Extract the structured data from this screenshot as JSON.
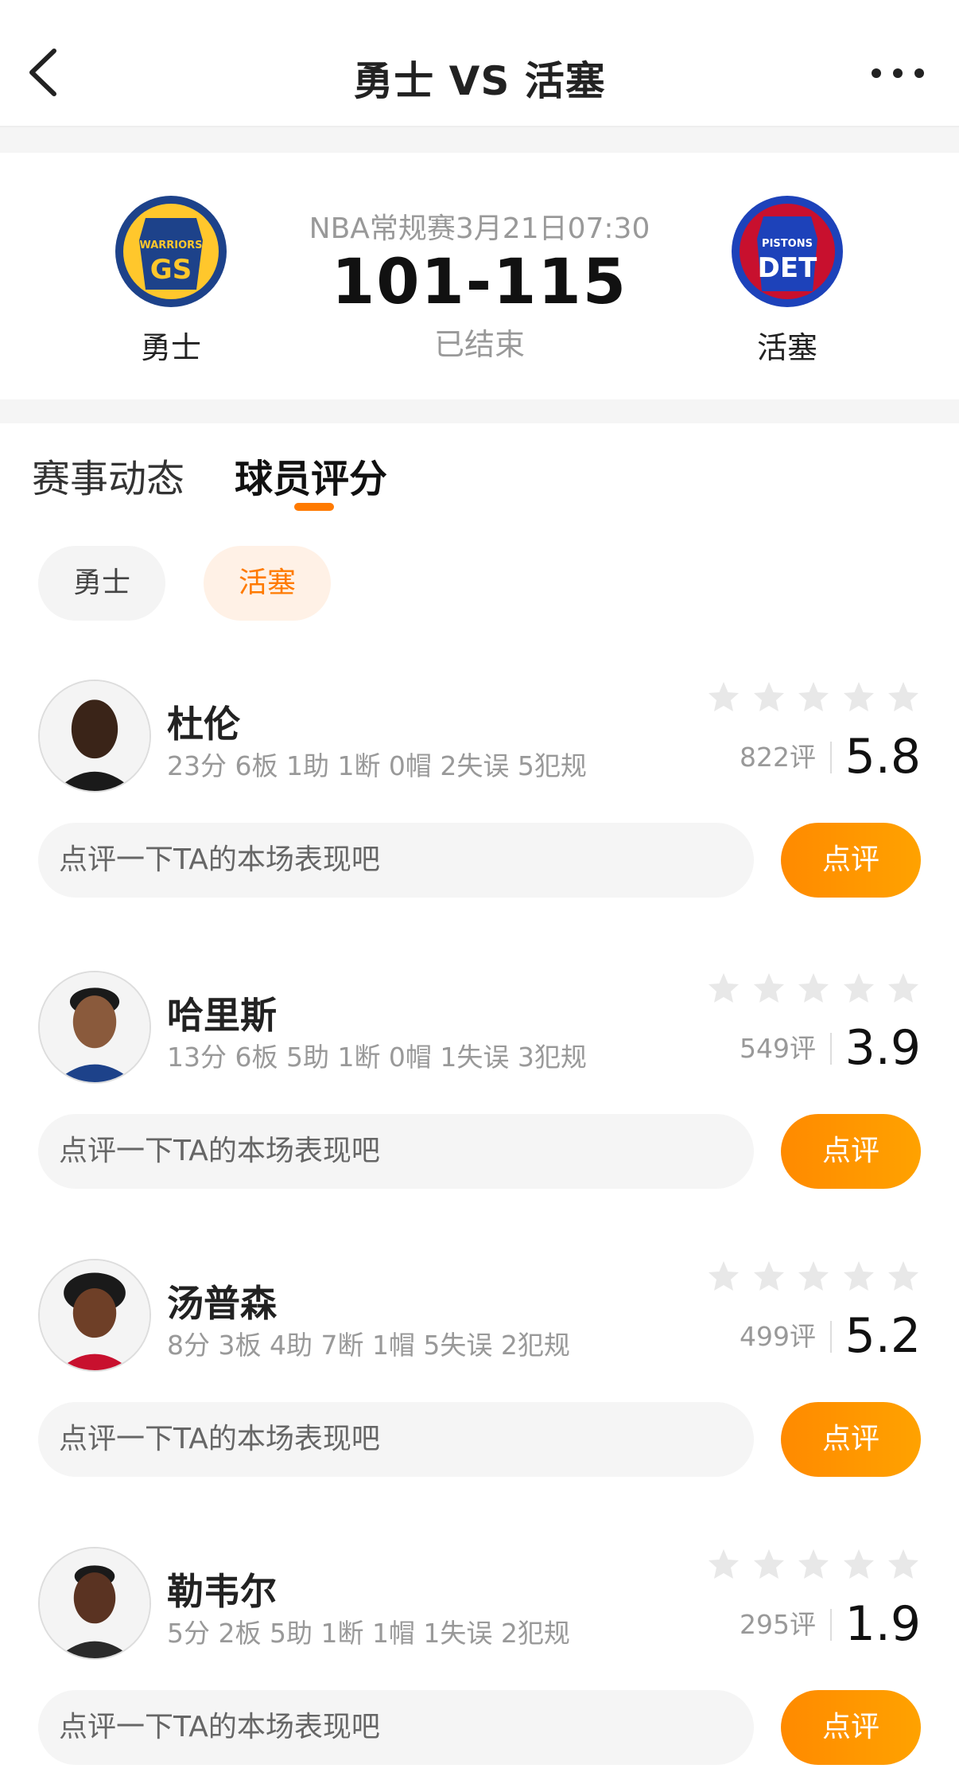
{
  "header": {
    "title": "勇士 VS 活塞"
  },
  "match": {
    "home_team": "勇士",
    "away_team": "活塞",
    "home_logo_text": "WARRIORS",
    "home_logo_abbr": "GS",
    "away_logo_text": "PISTONS",
    "away_logo_abbr": "DET",
    "league_time": "NBA常规赛3月21日07:30",
    "score": "101-115",
    "status": "已结束"
  },
  "tabs": [
    {
      "label": "赛事动态"
    },
    {
      "label": "球员评分"
    }
  ],
  "team_filter": [
    {
      "label": "勇士"
    },
    {
      "label": "活塞"
    }
  ],
  "colors": {
    "accent": "#ff7a00",
    "gs_blue": "#1d428a",
    "gs_gold": "#ffc72c",
    "det_red": "#c8102e",
    "det_blue": "#1d42ba"
  },
  "players": [
    {
      "name": "杜伦",
      "stats": "23分 6板 1助 1断 0帽 2失误 5犯规",
      "rating_count": "822评",
      "score": "5.8",
      "comment_placeholder": "点评一下TA的本场表现吧",
      "comment_btn": "点评",
      "avatar_icon": "player-avatar-icon"
    },
    {
      "name": "哈里斯",
      "stats": "13分 6板 5助 1断 0帽 1失误 3犯规",
      "rating_count": "549评",
      "score": "3.9",
      "comment_placeholder": "点评一下TA的本场表现吧",
      "comment_btn": "点评",
      "avatar_icon": "player-avatar-icon"
    },
    {
      "name": "汤普森",
      "stats": "8分 3板 4助 7断 1帽 5失误 2犯规",
      "rating_count": "499评",
      "score": "5.2",
      "comment_placeholder": "点评一下TA的本场表现吧",
      "comment_btn": "点评",
      "avatar_icon": "player-avatar-icon"
    },
    {
      "name": "勒韦尔",
      "stats": "5分 2板 5助 1断 1帽 1失误 2犯规",
      "rating_count": "295评",
      "score": "1.9",
      "comment_placeholder": "点评一下TA的本场表现吧",
      "comment_btn": "点评",
      "avatar_icon": "player-avatar-icon"
    }
  ]
}
